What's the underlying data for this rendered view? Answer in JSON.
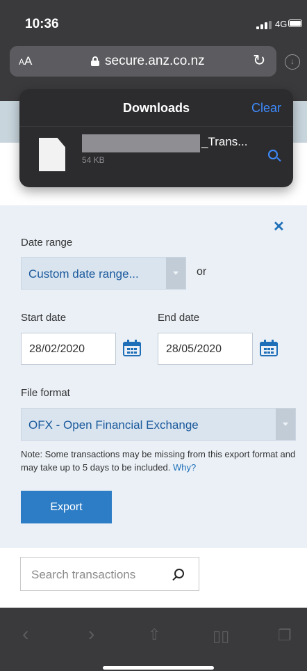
{
  "status_bar": {
    "time": "10:36",
    "network": "4G"
  },
  "browser": {
    "text_size_label": "AA",
    "url": "secure.anz.co.nz"
  },
  "downloads": {
    "title": "Downloads",
    "clear_label": "Clear",
    "file_name_visible": "_Trans...",
    "file_size": "54 KB"
  },
  "export_panel": {
    "date_range_label": "Date range",
    "date_range_value": "Custom date range...",
    "or_label": "or",
    "start_date_label": "Start date",
    "start_date_value": "28/02/2020",
    "end_date_label": "End date",
    "end_date_value": "28/05/2020",
    "file_format_label": "File format",
    "file_format_value": "OFX - Open Financial Exchange",
    "note_text": "Note: Some transactions may be missing from this export format and may take up to 5 days to be included.",
    "note_link": "Why?",
    "export_label": "Export"
  },
  "search": {
    "placeholder": "Search transactions"
  },
  "colors": {
    "accent": "#2d7dc6",
    "link": "#1e6fb8",
    "ios_blue": "#3e8cff",
    "chrome": "#3a3a3c"
  }
}
